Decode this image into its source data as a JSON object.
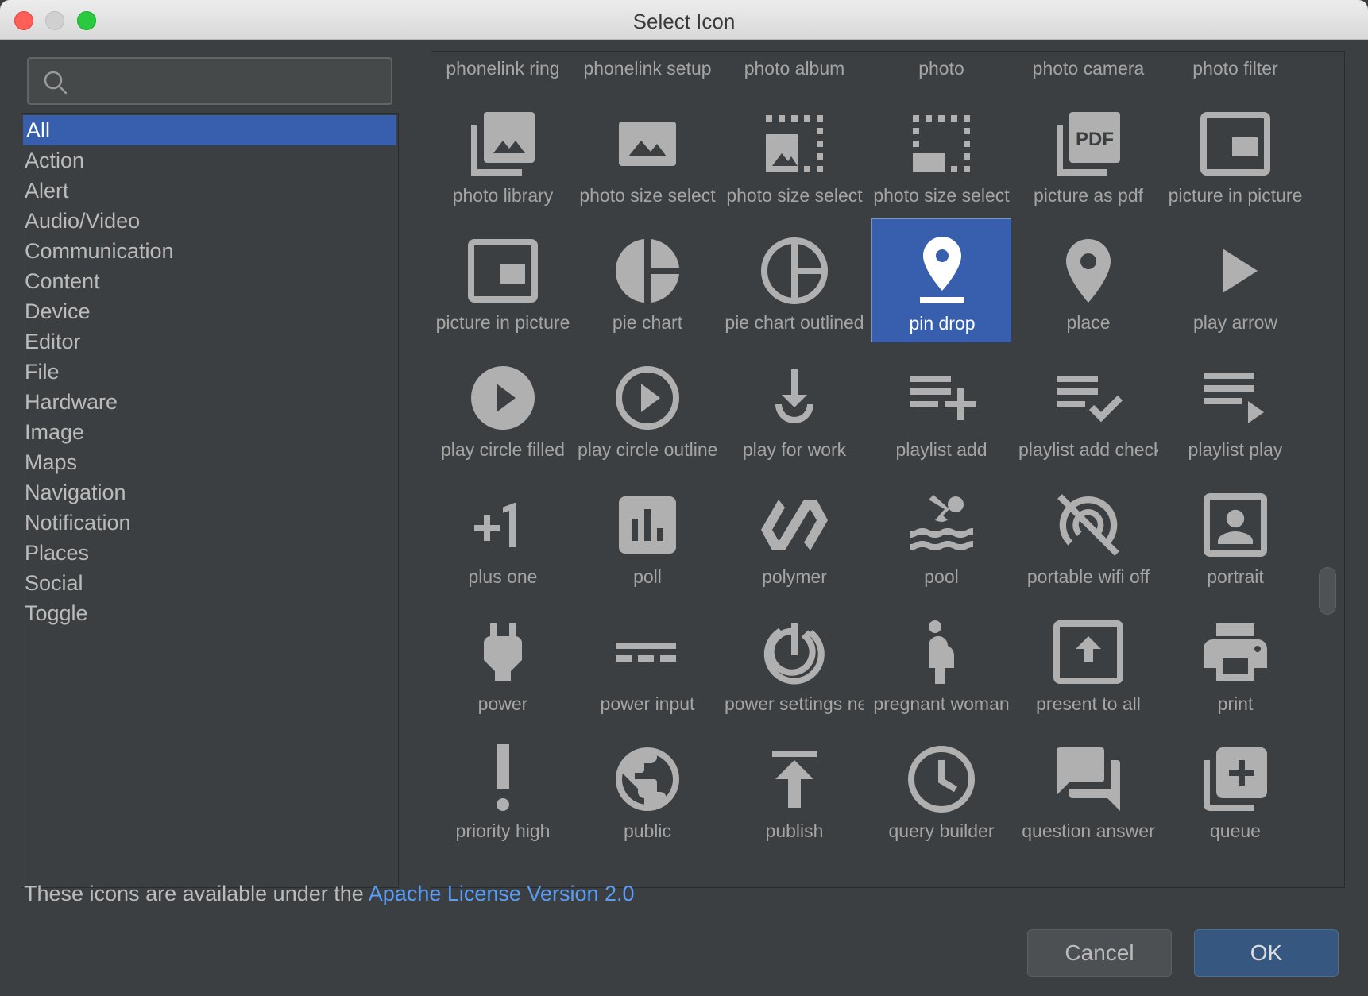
{
  "window": {
    "title": "Select Icon"
  },
  "search": {
    "value": "",
    "placeholder": ""
  },
  "categories": [
    "All",
    "Action",
    "Alert",
    "Audio/Video",
    "Communication",
    "Content",
    "Device",
    "Editor",
    "File",
    "Hardware",
    "Image",
    "Maps",
    "Navigation",
    "Notification",
    "Places",
    "Social",
    "Toggle"
  ],
  "selected_category": "All",
  "icons": [
    [
      "phonelink ring",
      "phonelink setup",
      "photo album",
      "photo",
      "photo camera",
      "photo filter"
    ],
    [
      "photo library",
      "photo size select",
      "photo size select",
      "photo size select",
      "picture as pdf",
      "picture in picture"
    ],
    [
      "picture in picture",
      "pie chart",
      "pie chart outlined",
      "pin drop",
      "place",
      "play arrow"
    ],
    [
      "play circle filled",
      "play circle outline",
      "play for work",
      "playlist add",
      "playlist add check",
      "playlist play"
    ],
    [
      "plus one",
      "poll",
      "polymer",
      "pool",
      "portable wifi off",
      "portrait"
    ],
    [
      "power",
      "power input",
      "power settings new",
      "pregnant woman",
      "present to all",
      "print"
    ],
    [
      "priority high",
      "public",
      "publish",
      "query builder",
      "question answer",
      "queue"
    ]
  ],
  "selected_icon": "pin drop",
  "footer": {
    "license_text": "These icons are available under the ",
    "license_link": "Apache License Version 2.0"
  },
  "buttons": {
    "cancel": "Cancel",
    "ok": "OK"
  },
  "colors": {
    "selection": "#375fad",
    "link": "#589df6",
    "background": "#3c3f41",
    "icon": "#b0b0b0"
  }
}
